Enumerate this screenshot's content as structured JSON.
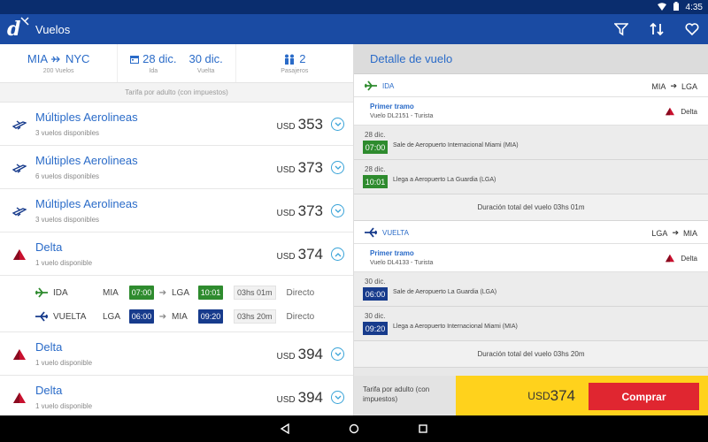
{
  "status": {
    "time": "4:35"
  },
  "app": {
    "title": "Vuelos",
    "logo": "d"
  },
  "search": {
    "route_from": "MIA",
    "route_to": "NYC",
    "flights_count": "200 Vuelos",
    "date_out": "28 dic.",
    "date_out_label": "Ida",
    "date_ret": "30 dic.",
    "date_ret_label": "Vuelta",
    "passengers": "2",
    "passengers_label": "Pasajeros"
  },
  "tarifa_note": "Tarifa por adulto (con impuestos)",
  "results": [
    {
      "airline": "Múltiples Aerolineas",
      "avail": "3 vuelos disponibles",
      "currency": "USD",
      "price": "353",
      "icon": "multi-airline-icon"
    },
    {
      "airline": "Múltiples Aerolineas",
      "avail": "6 vuelos disponibles",
      "currency": "USD",
      "price": "373",
      "icon": "multi-airline-icon"
    },
    {
      "airline": "Múltiples Aerolineas",
      "avail": "3 vuelos disponibles",
      "currency": "USD",
      "price": "373",
      "icon": "multi-airline-icon"
    },
    {
      "airline": "Delta",
      "avail": "1 vuelo disponible",
      "currency": "USD",
      "price": "374",
      "icon": "delta-logo-icon"
    },
    {
      "airline": "Delta",
      "avail": "1 vuelo disponible",
      "currency": "USD",
      "price": "394",
      "icon": "delta-logo-icon"
    },
    {
      "airline": "Delta",
      "avail": "1 vuelo disponible",
      "currency": "USD",
      "price": "394",
      "icon": "delta-logo-icon"
    }
  ],
  "expanded": {
    "ida": {
      "label": "IDA",
      "from": "MIA",
      "dep": "07:00",
      "to": "LGA",
      "arr": "10:01",
      "duration": "03hs 01m",
      "type": "Directo"
    },
    "vuelta": {
      "label": "VUELTA",
      "from": "LGA",
      "dep": "06:00",
      "to": "MIA",
      "arr": "09:20",
      "duration": "03hs 20m",
      "type": "Directo"
    }
  },
  "detail": {
    "title": "Detalle de vuelo",
    "ida": {
      "label": "IDA",
      "from": "MIA",
      "to": "LGA",
      "tramo_title": "Primer tramo",
      "flight": "Vuelo DL2151 - Turista",
      "airline": "Delta",
      "dep_date": "28 dic.",
      "dep_time": "07:00",
      "dep_desc": "Sale de Aeropuerto Internacional Miami (MIA)",
      "arr_date": "28 dic.",
      "arr_time": "10:01",
      "arr_desc": "Llega a Aeropuerto La Guardia (LGA)",
      "total": "Duración total del vuelo 03hs 01m"
    },
    "vuelta": {
      "label": "VUELTA",
      "from": "LGA",
      "to": "MIA",
      "tramo_title": "Primer tramo",
      "flight": "Vuelo DL4133 - Turista",
      "airline": "Delta",
      "dep_date": "30 dic.",
      "dep_time": "06:00",
      "dep_desc": "Sale de Aeropuerto La Guardia (LGA)",
      "arr_date": "30 dic.",
      "arr_time": "09:20",
      "arr_desc": "Llega a Aeropuerto Internacional Miami (MIA)",
      "total": "Duración total del vuelo 03hs 20m"
    }
  },
  "footer": {
    "label": "Tarifa por adulto (con impuestos)",
    "currency": "USD",
    "price": "374",
    "buy": "Comprar"
  },
  "colors": {
    "appbar": "#1a4ba3",
    "link": "#2a6bc8",
    "green": "#2e8b2e",
    "navy": "#173b8c",
    "yellow": "#ffd21c",
    "red": "#e02630",
    "delta": "#c8102e"
  }
}
